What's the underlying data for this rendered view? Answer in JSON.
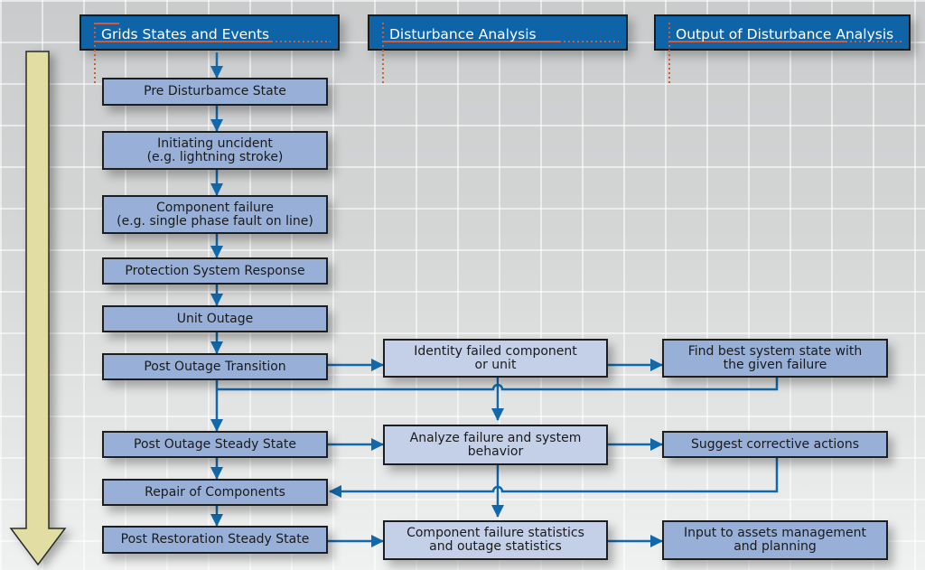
{
  "diagram": {
    "type": "flowchart",
    "colors": {
      "header_fill": "#0f64a8",
      "state_box_fill": "#98b0d8",
      "analysis_box_fill": "#c3d0e8",
      "connector": "#1168aa",
      "accent_dotted": "#d45a35",
      "time_arrow_fill": "#e2dea3"
    },
    "headers": [
      {
        "id": "h1",
        "label": "Grids States and Events"
      },
      {
        "id": "h2",
        "label": "Disturbance Analysis"
      },
      {
        "id": "h3",
        "label": "Output of Disturbance Analysis"
      }
    ],
    "states": [
      {
        "id": "s1",
        "label": "Pre Disturbamce State"
      },
      {
        "id": "s2",
        "label": "Initiating uncident\n(e.g. lightning stroke)"
      },
      {
        "id": "s3",
        "label": "Component failure\n(e.g. single phase fault on line)"
      },
      {
        "id": "s4",
        "label": "Protection System Response"
      },
      {
        "id": "s5",
        "label": "Unit Outage"
      },
      {
        "id": "s6",
        "label": "Post Outage Transition"
      },
      {
        "id": "s7",
        "label": "Post Outage Steady State"
      },
      {
        "id": "s8",
        "label": "Repair of Components"
      },
      {
        "id": "s9",
        "label": "Post Restoration Steady State"
      }
    ],
    "analysis": [
      {
        "id": "a1",
        "label": "Identity failed component\nor unit"
      },
      {
        "id": "a2",
        "label": "Analyze failure and system\nbehavior"
      },
      {
        "id": "a3",
        "label": "Component failure statistics\nand outage statistics"
      }
    ],
    "outputs": [
      {
        "id": "o1",
        "label": "Find best system state with\nthe given failure"
      },
      {
        "id": "o2",
        "label": "Suggest corrective actions"
      },
      {
        "id": "o3",
        "label": "Input to assets management\nand planning"
      }
    ],
    "edges": [
      {
        "from": "h1",
        "to": "s1"
      },
      {
        "from": "s1",
        "to": "s2"
      },
      {
        "from": "s2",
        "to": "s3"
      },
      {
        "from": "s3",
        "to": "s4"
      },
      {
        "from": "s4",
        "to": "s5"
      },
      {
        "from": "s5",
        "to": "s6"
      },
      {
        "from": "s6",
        "to": "s7"
      },
      {
        "from": "s6",
        "to": "a1"
      },
      {
        "from": "a1",
        "to": "o1"
      },
      {
        "from": "o1",
        "to": "s7"
      },
      {
        "from": "a1",
        "to": "a2"
      },
      {
        "from": "s7",
        "to": "a2"
      },
      {
        "from": "a2",
        "to": "o2"
      },
      {
        "from": "s7",
        "to": "s8"
      },
      {
        "from": "o2",
        "to": "s8"
      },
      {
        "from": "a2",
        "to": "a3"
      },
      {
        "from": "s8",
        "to": "s9"
      },
      {
        "from": "s9",
        "to": "a3"
      },
      {
        "from": "a3",
        "to": "o3"
      }
    ],
    "time_arrow": {
      "direction": "down",
      "meaning": "time progression"
    }
  }
}
